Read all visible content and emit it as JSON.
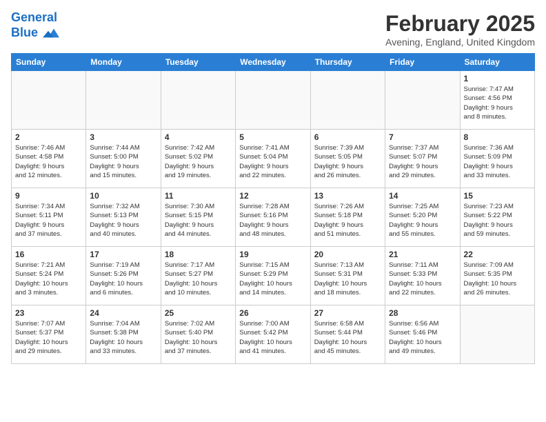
{
  "header": {
    "logo_line1": "General",
    "logo_line2": "Blue",
    "month_title": "February 2025",
    "subtitle": "Avening, England, United Kingdom"
  },
  "days_of_week": [
    "Sunday",
    "Monday",
    "Tuesday",
    "Wednesday",
    "Thursday",
    "Friday",
    "Saturday"
  ],
  "weeks": [
    [
      {
        "day": "",
        "info": ""
      },
      {
        "day": "",
        "info": ""
      },
      {
        "day": "",
        "info": ""
      },
      {
        "day": "",
        "info": ""
      },
      {
        "day": "",
        "info": ""
      },
      {
        "day": "",
        "info": ""
      },
      {
        "day": "1",
        "info": "Sunrise: 7:47 AM\nSunset: 4:56 PM\nDaylight: 9 hours\nand 8 minutes."
      }
    ],
    [
      {
        "day": "2",
        "info": "Sunrise: 7:46 AM\nSunset: 4:58 PM\nDaylight: 9 hours\nand 12 minutes."
      },
      {
        "day": "3",
        "info": "Sunrise: 7:44 AM\nSunset: 5:00 PM\nDaylight: 9 hours\nand 15 minutes."
      },
      {
        "day": "4",
        "info": "Sunrise: 7:42 AM\nSunset: 5:02 PM\nDaylight: 9 hours\nand 19 minutes."
      },
      {
        "day": "5",
        "info": "Sunrise: 7:41 AM\nSunset: 5:04 PM\nDaylight: 9 hours\nand 22 minutes."
      },
      {
        "day": "6",
        "info": "Sunrise: 7:39 AM\nSunset: 5:05 PM\nDaylight: 9 hours\nand 26 minutes."
      },
      {
        "day": "7",
        "info": "Sunrise: 7:37 AM\nSunset: 5:07 PM\nDaylight: 9 hours\nand 29 minutes."
      },
      {
        "day": "8",
        "info": "Sunrise: 7:36 AM\nSunset: 5:09 PM\nDaylight: 9 hours\nand 33 minutes."
      }
    ],
    [
      {
        "day": "9",
        "info": "Sunrise: 7:34 AM\nSunset: 5:11 PM\nDaylight: 9 hours\nand 37 minutes."
      },
      {
        "day": "10",
        "info": "Sunrise: 7:32 AM\nSunset: 5:13 PM\nDaylight: 9 hours\nand 40 minutes."
      },
      {
        "day": "11",
        "info": "Sunrise: 7:30 AM\nSunset: 5:15 PM\nDaylight: 9 hours\nand 44 minutes."
      },
      {
        "day": "12",
        "info": "Sunrise: 7:28 AM\nSunset: 5:16 PM\nDaylight: 9 hours\nand 48 minutes."
      },
      {
        "day": "13",
        "info": "Sunrise: 7:26 AM\nSunset: 5:18 PM\nDaylight: 9 hours\nand 51 minutes."
      },
      {
        "day": "14",
        "info": "Sunrise: 7:25 AM\nSunset: 5:20 PM\nDaylight: 9 hours\nand 55 minutes."
      },
      {
        "day": "15",
        "info": "Sunrise: 7:23 AM\nSunset: 5:22 PM\nDaylight: 9 hours\nand 59 minutes."
      }
    ],
    [
      {
        "day": "16",
        "info": "Sunrise: 7:21 AM\nSunset: 5:24 PM\nDaylight: 10 hours\nand 3 minutes."
      },
      {
        "day": "17",
        "info": "Sunrise: 7:19 AM\nSunset: 5:26 PM\nDaylight: 10 hours\nand 6 minutes."
      },
      {
        "day": "18",
        "info": "Sunrise: 7:17 AM\nSunset: 5:27 PM\nDaylight: 10 hours\nand 10 minutes."
      },
      {
        "day": "19",
        "info": "Sunrise: 7:15 AM\nSunset: 5:29 PM\nDaylight: 10 hours\nand 14 minutes."
      },
      {
        "day": "20",
        "info": "Sunrise: 7:13 AM\nSunset: 5:31 PM\nDaylight: 10 hours\nand 18 minutes."
      },
      {
        "day": "21",
        "info": "Sunrise: 7:11 AM\nSunset: 5:33 PM\nDaylight: 10 hours\nand 22 minutes."
      },
      {
        "day": "22",
        "info": "Sunrise: 7:09 AM\nSunset: 5:35 PM\nDaylight: 10 hours\nand 26 minutes."
      }
    ],
    [
      {
        "day": "23",
        "info": "Sunrise: 7:07 AM\nSunset: 5:37 PM\nDaylight: 10 hours\nand 29 minutes."
      },
      {
        "day": "24",
        "info": "Sunrise: 7:04 AM\nSunset: 5:38 PM\nDaylight: 10 hours\nand 33 minutes."
      },
      {
        "day": "25",
        "info": "Sunrise: 7:02 AM\nSunset: 5:40 PM\nDaylight: 10 hours\nand 37 minutes."
      },
      {
        "day": "26",
        "info": "Sunrise: 7:00 AM\nSunset: 5:42 PM\nDaylight: 10 hours\nand 41 minutes."
      },
      {
        "day": "27",
        "info": "Sunrise: 6:58 AM\nSunset: 5:44 PM\nDaylight: 10 hours\nand 45 minutes."
      },
      {
        "day": "28",
        "info": "Sunrise: 6:56 AM\nSunset: 5:46 PM\nDaylight: 10 hours\nand 49 minutes."
      },
      {
        "day": "",
        "info": ""
      }
    ]
  ]
}
